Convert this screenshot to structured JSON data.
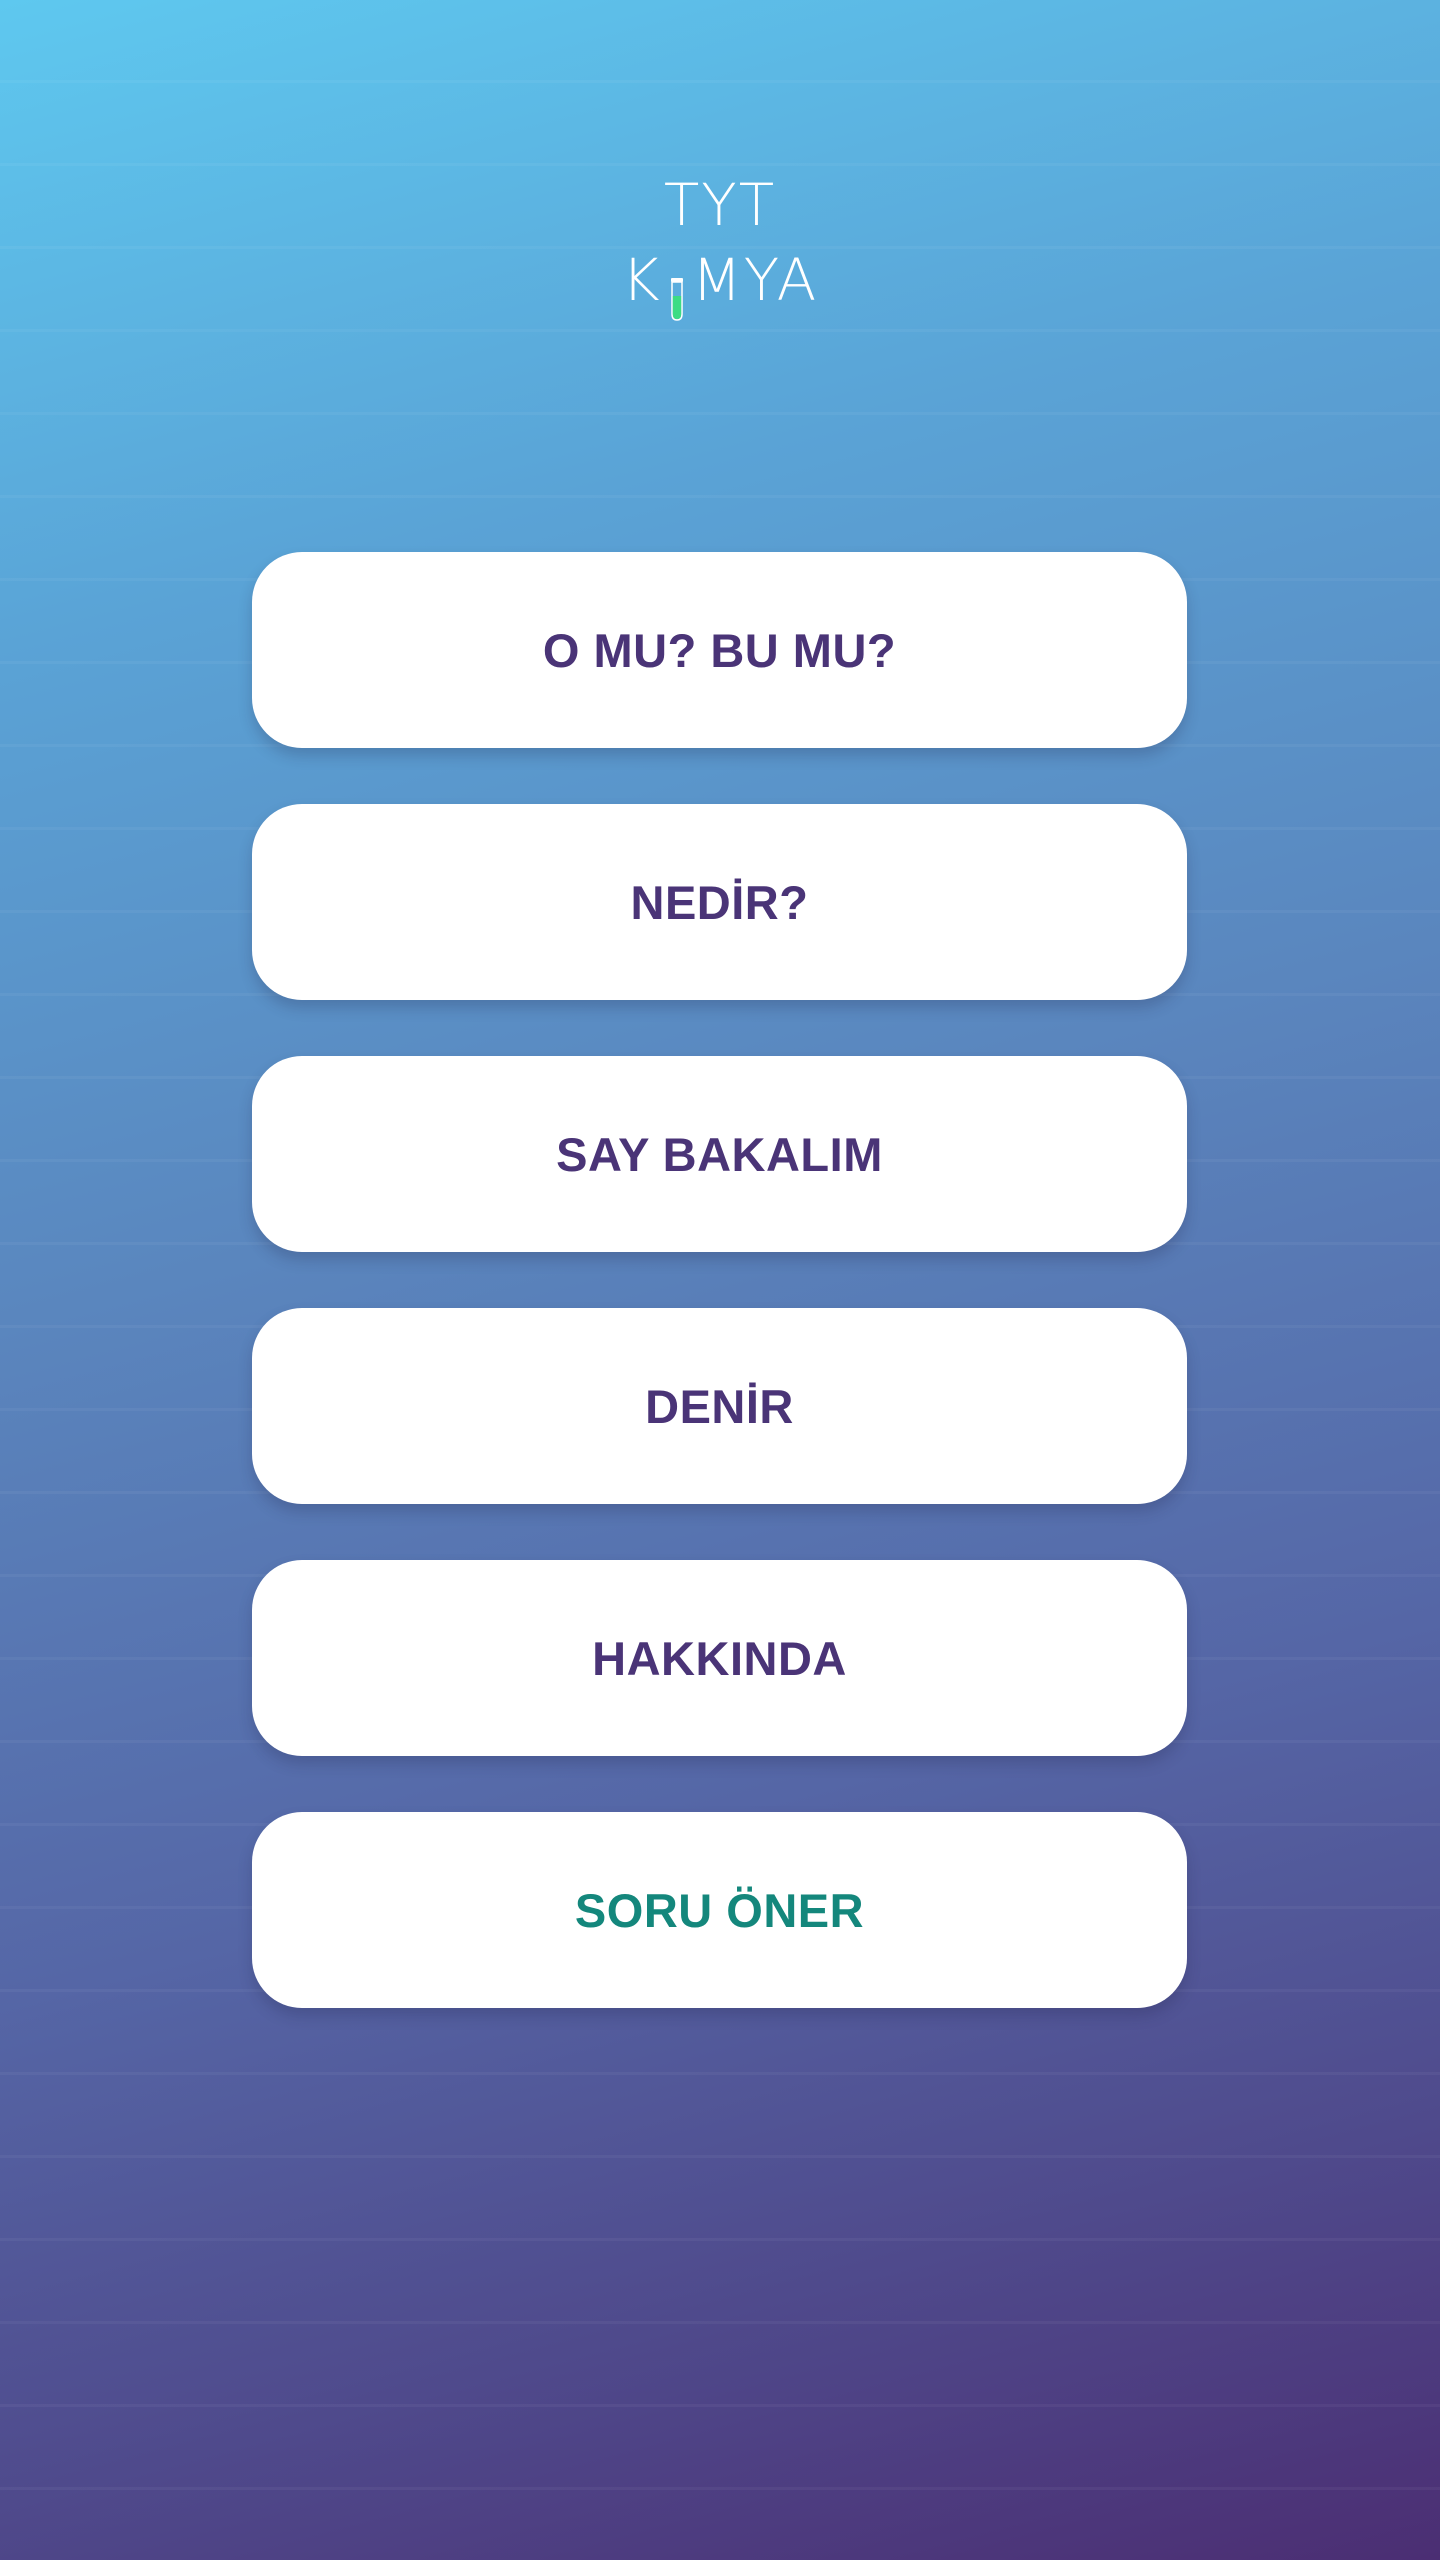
{
  "app": {
    "title_line1": "TYT",
    "title_line2_before_icon": "K",
    "title_line2_after_icon": "MYA",
    "icon": "test-tube-icon"
  },
  "menu": {
    "items": [
      {
        "label": "O MU? BU MU?",
        "accent": false
      },
      {
        "label": "NEDİR?",
        "accent": false
      },
      {
        "label": "SAY BAKALIM",
        "accent": false
      },
      {
        "label": "DENİR",
        "accent": false
      },
      {
        "label": "HAKKINDA",
        "accent": false
      },
      {
        "label": "SORU ÖNER",
        "accent": true
      }
    ]
  },
  "colors": {
    "button_text": "#4a3477",
    "accent_text": "#14877c",
    "tube_liquid": "#3ddc84",
    "gradient_top": "#5ec8ef",
    "gradient_bottom": "#4b2e73"
  }
}
